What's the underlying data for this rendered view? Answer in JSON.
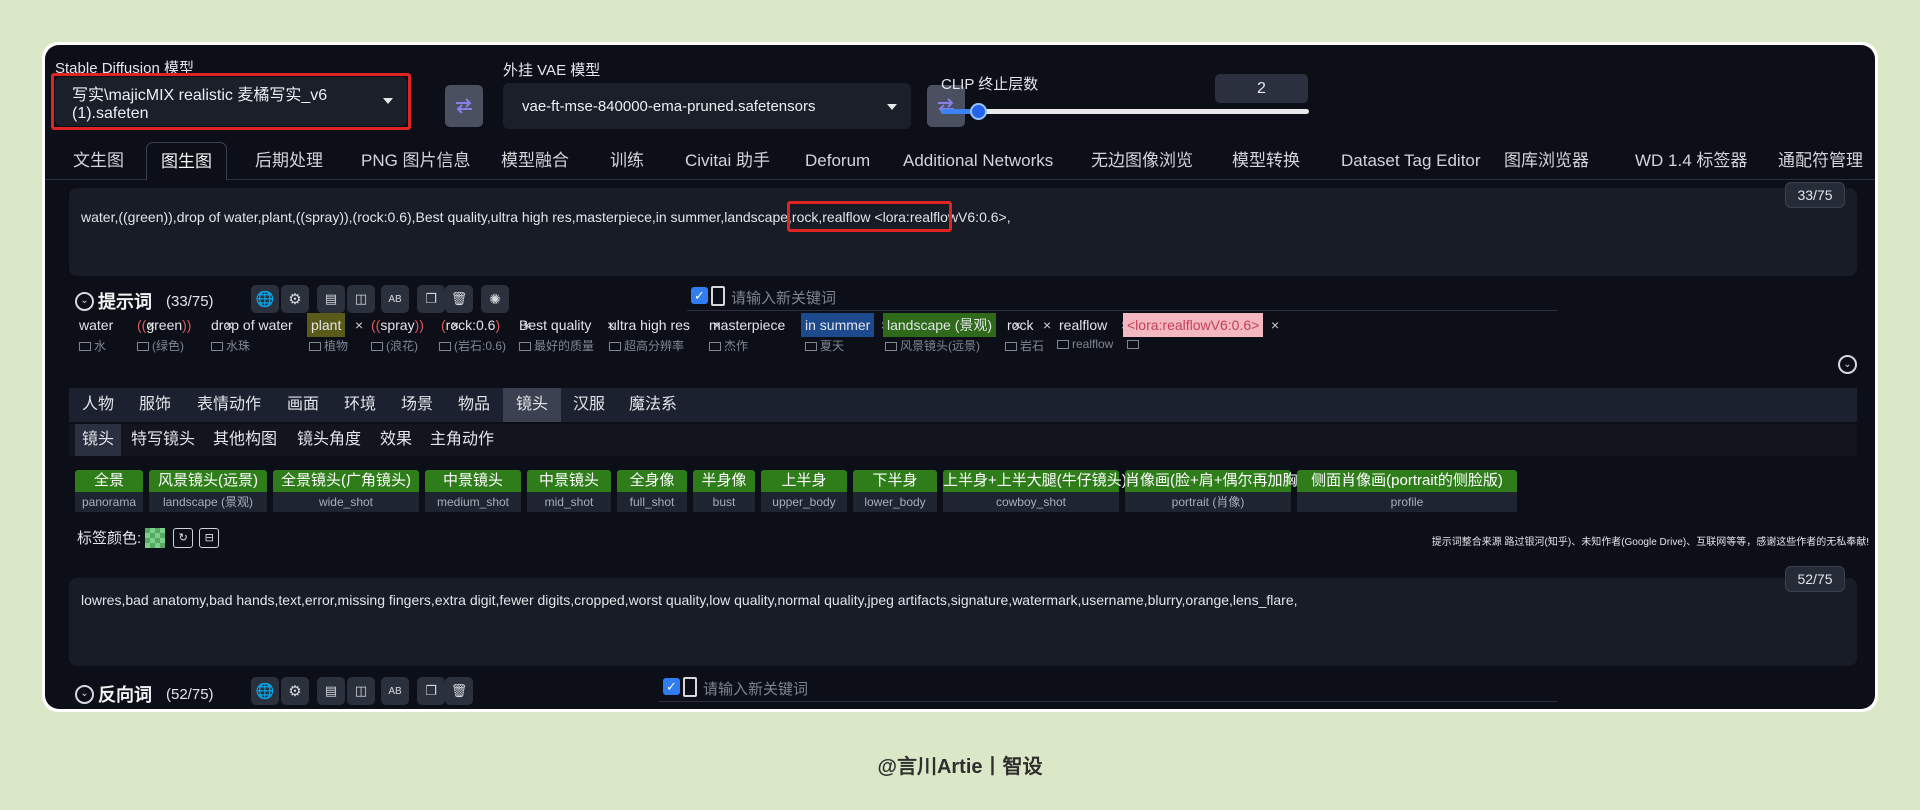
{
  "top": {
    "sd_model_label": "Stable Diffusion 模型",
    "sd_model_value": "写实\\majicMIX realistic 麦橘写实_v6 (1).safeten",
    "vae_label": "外挂 VAE 模型",
    "vae_value": "vae-ft-mse-840000-ema-pruned.safetensors",
    "clip_label": "CLIP 终止层数",
    "clip_value": "2",
    "clip_slider_fraction": 0.08
  },
  "tabs": [
    "文生图",
    "图生图",
    "后期处理",
    "PNG 图片信息",
    "模型融合",
    "训练",
    "Civitai 助手",
    "Deforum",
    "Additional Networks",
    "无边图像浏览",
    "模型转换",
    "Dataset Tag Editor",
    "图库浏览器",
    "WD 1.4 标签器",
    "通配符管理"
  ],
  "active_tab": "图生图",
  "prompt": {
    "text": "water,((green)),drop of water,plant,((spray)),(rock:0.6),Best quality,ultra high res,masterpiece,in summer,landscape,rock,realflow ",
    "lora": "<lora:realflowV6:0.6>,",
    "counter": "33/75",
    "section_title": "提示词",
    "section_count": "(33/75)",
    "keyword_placeholder": "请输入新关键词"
  },
  "chips": [
    {
      "text": "water",
      "paren": false,
      "sub": "水"
    },
    {
      "text": "green",
      "paren": true,
      "sub": "(绿色)"
    },
    {
      "text": "drop of water",
      "paren": false,
      "sub": "水珠"
    },
    {
      "text": "plant",
      "paren": false,
      "sub": "植物",
      "highlight": "olive"
    },
    {
      "text": "spray",
      "paren": true,
      "sub": "(浪花)"
    },
    {
      "text": "rock:0.6",
      "paren": true,
      "sub": "(岩石:0.6)"
    },
    {
      "text": "Best quality",
      "paren": false,
      "sub": "最好的质量"
    },
    {
      "text": "ultra high res",
      "paren": false,
      "sub": "超高分辨率"
    },
    {
      "text": "masterpiece",
      "paren": false,
      "sub": "杰作"
    },
    {
      "text": "in summer",
      "paren": false,
      "sub": "夏天",
      "highlight": "blue"
    },
    {
      "text": "landscape (景观)",
      "paren": false,
      "sub": "风景镜头(远景)",
      "highlight": "green"
    },
    {
      "text": "rock",
      "paren": false,
      "sub": "岩石"
    },
    {
      "text": "realflow",
      "paren": false,
      "sub": "realflow"
    },
    {
      "text": "<lora:realflowV6:0.6>",
      "paren": false,
      "sub": "",
      "highlight": "pink"
    }
  ],
  "categories": [
    "人物",
    "服饰",
    "表情动作",
    "画面",
    "环境",
    "场景",
    "物品",
    "镜头",
    "汉服",
    "魔法系"
  ],
  "active_category": "镜头",
  "subcategories": [
    "镜头",
    "特写镜头",
    "其他构图",
    "镜头角度",
    "效果",
    "主角动作"
  ],
  "active_subcategory": "镜头",
  "presets": [
    {
      "zh": "全景",
      "en": "panorama"
    },
    {
      "zh": "风景镜头(远景)",
      "en": "landscape (景观)"
    },
    {
      "zh": "全景镜头(广角镜头)",
      "en": "wide_shot"
    },
    {
      "zh": "中景镜头",
      "en": "medium_shot"
    },
    {
      "zh": "中景镜头",
      "en": "mid_shot"
    },
    {
      "zh": "全身像",
      "en": "full_shot"
    },
    {
      "zh": "半身像",
      "en": "bust"
    },
    {
      "zh": "上半身",
      "en": "upper_body"
    },
    {
      "zh": "下半身",
      "en": "lower_body"
    },
    {
      "zh": "上半身+上半大腿(牛仔镜头)",
      "en": "cowboy_shot"
    },
    {
      "zh": "肖像画(脸+肩+偶尔再加胸)",
      "en": "portrait (肖像)"
    },
    {
      "zh": "侧面肖像画(portrait的侧脸版)",
      "en": "profile"
    }
  ],
  "tag_color_label": "标签颜色:",
  "credit_text": "提示词整合来源 路过银河(知乎)、未知作者(Google Drive)、互联网等等，感谢这些作者的无私奉献!",
  "negative": {
    "text": "lowres,bad anatomy,bad hands,text,error,missing fingers,extra digit,fewer digits,cropped,worst quality,low quality,normal quality,jpeg artifacts,signature,watermark,username,blurry,orange,lens_flare,",
    "counter": "52/75",
    "section_title": "反向词",
    "section_count": "(52/75)",
    "keyword_placeholder": "请输入新关键词"
  },
  "caption": "@言川Artie丨智设",
  "colors": {
    "accent": "#2f7df1",
    "preset_green": "#2e7d1a",
    "highlight_red": "#e02424"
  }
}
